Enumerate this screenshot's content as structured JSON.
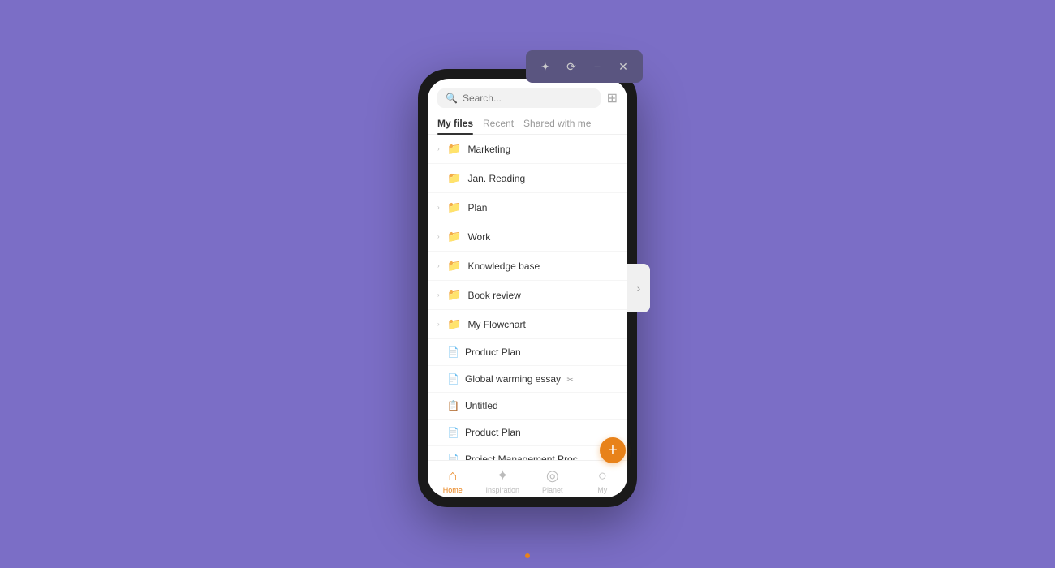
{
  "window_controls": {
    "star_label": "★",
    "history_label": "⟳",
    "minimize_label": "−",
    "close_label": "✕"
  },
  "search": {
    "placeholder": "Search..."
  },
  "tabs": [
    {
      "id": "my-files",
      "label": "My files",
      "active": true
    },
    {
      "id": "recent",
      "label": "Recent",
      "active": false
    },
    {
      "id": "shared",
      "label": "Shared with me",
      "active": false
    }
  ],
  "folders": [
    {
      "name": "Marketing",
      "type": "folder"
    },
    {
      "name": "Jan. Reading",
      "type": "folder"
    },
    {
      "name": "Plan",
      "type": "folder"
    },
    {
      "name": "Work",
      "type": "folder"
    },
    {
      "name": "Knowledge base",
      "type": "folder"
    },
    {
      "name": "Book review",
      "type": "folder"
    },
    {
      "name": "My Flowchart",
      "type": "folder"
    }
  ],
  "files": [
    {
      "name": "Product Plan",
      "type": "doc",
      "shared": false
    },
    {
      "name": "Global warming essay",
      "type": "doc",
      "shared": true
    },
    {
      "name": "Untitled",
      "type": "doc-blue",
      "shared": false
    },
    {
      "name": "Product Plan",
      "type": "doc",
      "shared": false
    },
    {
      "name": "Project Management Proc...",
      "type": "doc",
      "shared": false
    }
  ],
  "nav": [
    {
      "id": "home",
      "label": "Home",
      "icon": "⌂",
      "active": true
    },
    {
      "id": "inspiration",
      "label": "Inspiration",
      "icon": "✦",
      "active": false
    },
    {
      "id": "planet",
      "label": "Planet",
      "icon": "◎",
      "active": false
    },
    {
      "id": "my",
      "label": "My",
      "icon": "○",
      "active": false
    }
  ],
  "fab_label": "+",
  "side_arrow": "›",
  "folder_color": "#F5B731",
  "accent_color": "#E8821A"
}
